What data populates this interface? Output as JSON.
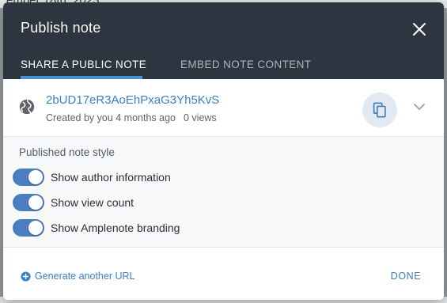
{
  "background": {
    "partial_text": "ember 18th, 2023"
  },
  "dialog": {
    "title": "Publish note",
    "tabs": [
      {
        "label": "SHARE A PUBLIC NOTE",
        "active": true
      },
      {
        "label": "EMBED NOTE CONTENT",
        "active": false
      }
    ],
    "public_url": {
      "slug": "2bUD17eR3AoEhPxaG3Yh5KvS",
      "created_by": "Created by you 4 months ago",
      "views": "0 views"
    },
    "style_section": {
      "label": "Published note style",
      "toggles": [
        {
          "label": "Show author information",
          "on": true
        },
        {
          "label": "Show view count",
          "on": true
        },
        {
          "label": "Show Amplenote branding",
          "on": true
        }
      ]
    },
    "footer": {
      "generate_label": "Generate another URL",
      "done_label": "DONE"
    }
  },
  "colors": {
    "header_bg": "#2d3540",
    "accent": "#3b7fc4",
    "toggle_on": "#4a7fbf",
    "tab_underline": "#4a8fd6"
  },
  "icons": {
    "close": "close-icon",
    "globe": "globe-icon",
    "copy": "copy-icon",
    "expand": "chevron-down-icon",
    "generate": "plus-circle-icon"
  }
}
